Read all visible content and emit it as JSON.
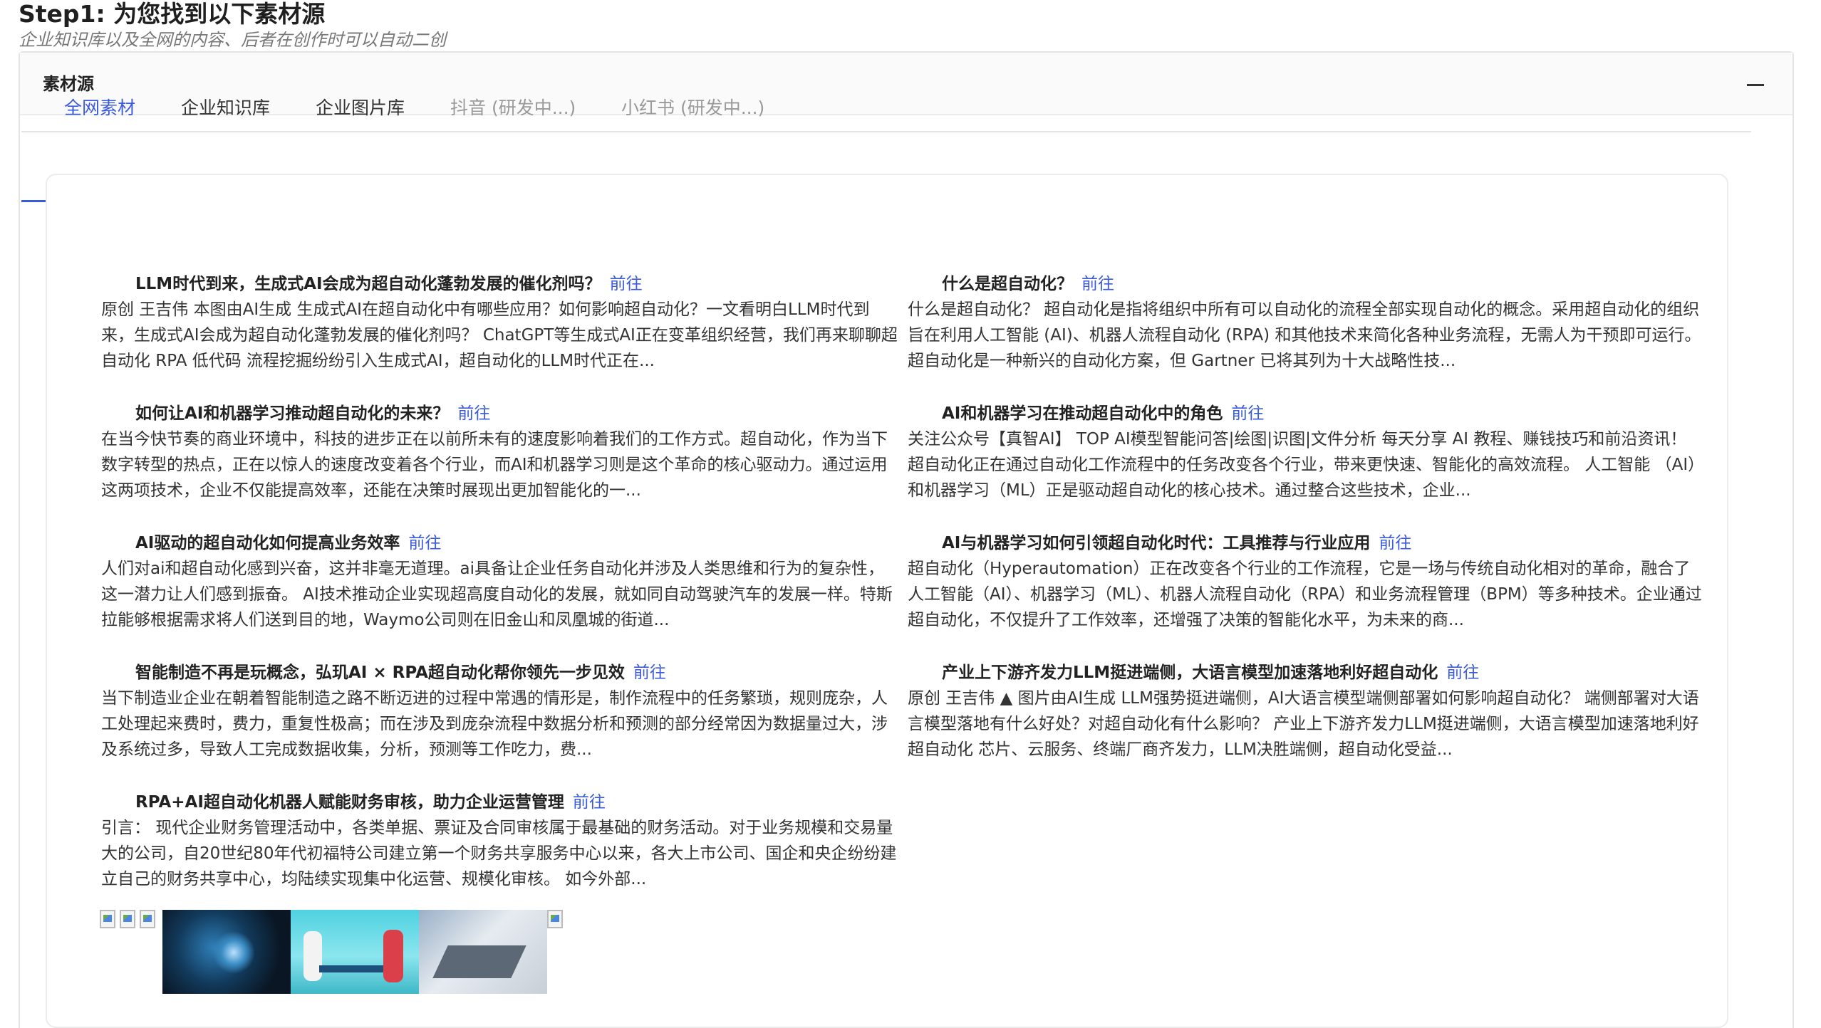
{
  "step": {
    "title": "Step1: 为您找到以下素材源",
    "subtitle": "企业知识库以及全网的内容、后者在创作时可以自动二创"
  },
  "panel": {
    "title": "素材源",
    "collapse_icon": "minus-icon"
  },
  "tabs": [
    {
      "label": "全网素材",
      "state": "active"
    },
    {
      "label": "企业知识库",
      "state": "normal"
    },
    {
      "label": "企业图片库",
      "state": "normal"
    },
    {
      "label": "抖音 (研发中...)",
      "state": "disabled"
    },
    {
      "label": "小红书 (研发中...)",
      "state": "disabled"
    }
  ],
  "go_label": "前往",
  "items": [
    {
      "title": "LLM时代到来，生成式AI会成为超自动化蓬勃发展的催化剂吗？",
      "body": "原创 王吉伟 本图由AI生成 生成式AI在超自动化中有哪些应用？如何影响超自动化？一文看明白LLM时代到来，生成式AI会成为超自动化蓬勃发展的催化剂吗？ ChatGPT等生成式AI正在变革组织经营，我们再来聊聊超自动化 RPA 低代码 流程挖掘纷纷引入生成式AI，超自动化的LLM时代正在..."
    },
    {
      "title": "什么是超自动化？",
      "body": "什么是超自动化？ 超自动化是指将组织中所有可以自动化的流程全部实现自动化的概念。采用超自动化的组织旨在利用人工智能 (AI)、机器人流程自动化 (RPA) 和其他技术来简化各种业务流程，无需人为干预即可运行。 超自动化是一种新兴的自动化方案，但 Gartner 已将其列为十大战略性技..."
    },
    {
      "title": "如何让AI和机器学习推动超自动化的未来？",
      "body": "在当今快节奏的商业环境中，科技的进步正在以前所未有的速度影响着我们的工作方式。超自动化，作为当下数字转型的热点，正在以惊人的速度改变着各个行业，而AI和机器学习则是这个革命的核心驱动力。通过运用这两项技术，企业不仅能提高效率，还能在决策时展现出更加智能化的一..."
    },
    {
      "title": "AI和机器学习在推动超自动化中的角色",
      "body": "关注公众号【真智AI】 TOP AI模型智能问答|绘图|识图|文件分析 每天分享 AI 教程、赚钱技巧和前沿资讯！ 超自动化正在通过自动化工作流程中的任务改变各个行业，带来更快速、智能化的高效流程。 人工智能 （AI）和机器学习（ML）正是驱动超自动化的核心技术。通过整合这些技术，企业..."
    },
    {
      "title": "AI驱动的超自动化如何提高业务效率",
      "body": "人们对ai和超自动化感到兴奋，这并非毫无道理。ai具备让企业任务自动化并涉及人类思维和行为的复杂性，这一潜力让人们感到振奋。 AI技术推动企业实现超高度自动化的发展，就如同自动驾驶汽车的发展一样。特斯拉能够根据需求将人们送到目的地，Waymo公司则在旧金山和凤凰城的街道..."
    },
    {
      "title": "AI与机器学习如何引领超自动化时代：工具推荐与行业应用",
      "body": "超自动化（Hyperautomation）正在改变各个行业的工作流程，它是一场与传统自动化相对的革命，融合了人工智能（AI）、机器学习（ML）、机器人流程自动化（RPA）和业务流程管理（BPM）等多种技术。企业通过超自动化，不仅提升了工作效率，还增强了决策的智能化水平，为未来的商..."
    },
    {
      "title": "智能制造不再是玩概念，弘玑AI × RPA超自动化帮你领先一步见效",
      "body": "  当下制造业企业在朝着智能制造之路不断迈进的过程中常遇的情形是，制作流程中的任务繁琐，规则庞杂，人工处理起来费时，费力，重复性极高；而在涉及到庞杂流程中数据分析和预测的部分经常因为数据量过大，涉及系统过多，导致人工完成数据收集，分析，预测等工作吃力，费..."
    },
    {
      "title": "产业上下游齐发力LLM挺进端侧，大语言模型加速落地利好超自动化",
      "body": "原创 王吉伟 ▲ 图片由AI生成 LLM强势挺进端侧，AI大语言模型端侧部署如何影响超自动化？ 端侧部署对大语言模型落地有什么好处？对超自动化有什么影响？ 产业上下游齐发力LLM挺进端侧，大语言模型加速落地利好超自动化 芯片、云服务、终端厂商齐发力，LLM决胜端侧，超自动化受益..."
    },
    {
      "title": "RPA+AI超自动化机器人赋能财务审核，助力企业运营管理",
      "body": "引言： 现代企业财务管理活动中，各类单据、票证及合同审核属于最基础的财务活动。对于业务规模和交易量大的公司，自20世纪80年代初福特公司建立第一个财务共享服务中心以来，各大上市公司、国企和央企纷纷建立自己的财务共享中心，均陆续实现集中化运营、规模化审核。 如今外部..."
    }
  ],
  "images": [
    "broken-image-icon",
    "broken-image-icon",
    "broken-image-icon",
    "robot-welding-image",
    "robots-at-desk-image",
    "handshake-laptop-image",
    "broken-image-icon"
  ]
}
